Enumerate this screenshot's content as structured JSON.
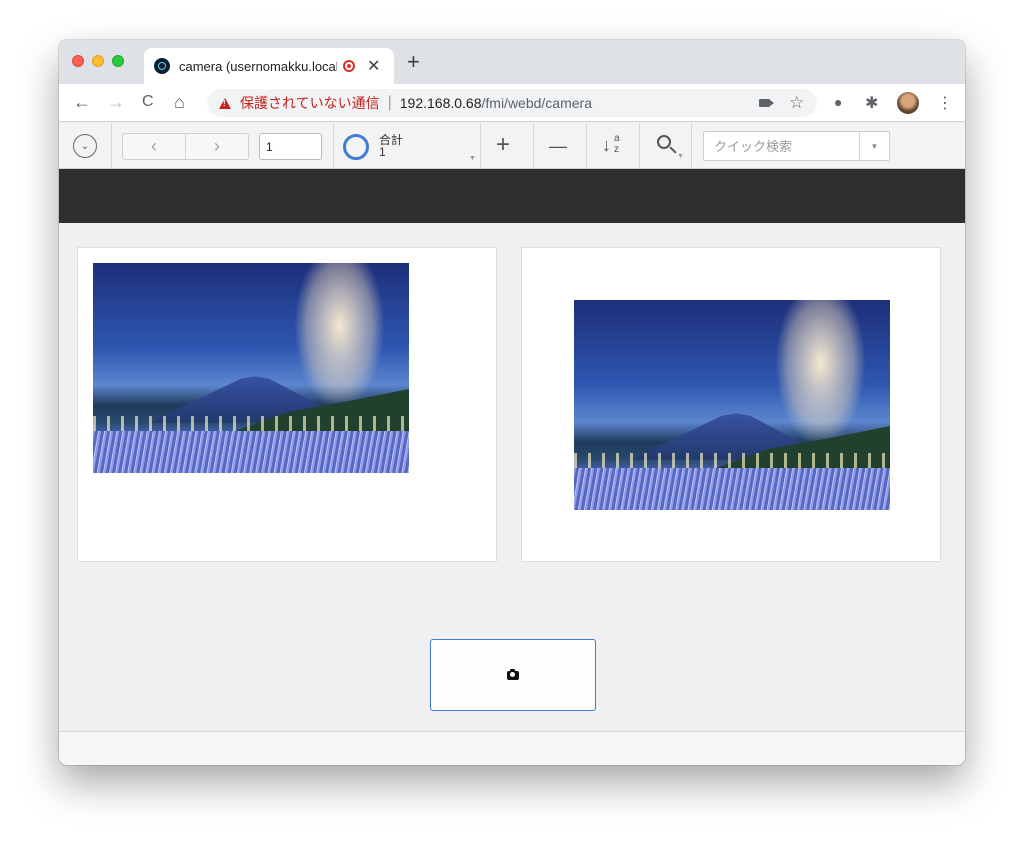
{
  "browser": {
    "tab_title": "camera (usernomakku.local)",
    "new_tab_symbol": "+",
    "close_symbol": "✕",
    "nav": {
      "back": "←",
      "forward": "→",
      "reload": "C",
      "home": "⌂"
    },
    "address": {
      "security_warning": "保護されていない通信",
      "separator": "|",
      "host": "192.168.0.68",
      "path": "/fmi/webd/camera"
    },
    "toolbar_icons": {
      "bookmark": "☆",
      "extensions": "✱",
      "menu": "⋮",
      "dot": "●"
    }
  },
  "app_toolbar": {
    "expand_symbol": "⌄",
    "prev_symbol": "‹",
    "next_symbol": "›",
    "record_number": "1",
    "total_label": "合計",
    "total_value": "1",
    "add_symbol": "+",
    "delete_symbol": "—",
    "sort_arrow": "↓",
    "sort_a": "a",
    "sort_z": "z",
    "caret": "▼",
    "quick_search_placeholder": "クイック検索"
  },
  "colors": {
    "accent": "#3d7dd8",
    "warning": "#c5221f",
    "header_band": "#2f2f2f"
  }
}
